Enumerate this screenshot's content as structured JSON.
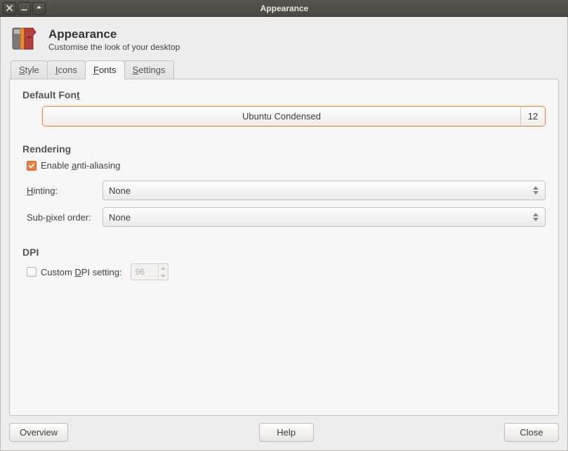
{
  "window_title": "Appearance",
  "header": {
    "title": "Appearance",
    "subtitle": "Customise the look of your desktop"
  },
  "tabs": [
    {
      "label": "Style",
      "accel": "S"
    },
    {
      "label": "Icons",
      "accel": "I"
    },
    {
      "label": "Fonts",
      "accel": "F"
    },
    {
      "label": "Settings",
      "accel": "S"
    }
  ],
  "active_tab_index": 2,
  "fonts": {
    "section_label": "Default Font",
    "font_name": "Ubuntu Condensed",
    "font_size": "12"
  },
  "rendering": {
    "section_label": "Rendering",
    "anti_aliasing": {
      "label": "Enable anti-aliasing",
      "checked": true
    },
    "hinting": {
      "label": "Hinting:",
      "value": "None"
    },
    "subpixel": {
      "label": "Sub-pixel order:",
      "value": "None"
    }
  },
  "dpi": {
    "section_label": "DPI",
    "custom": {
      "label": "Custom DPI setting:",
      "checked": false,
      "value": "96"
    }
  },
  "buttons": {
    "overview": "Overview",
    "help": "Help",
    "close": "Close"
  }
}
